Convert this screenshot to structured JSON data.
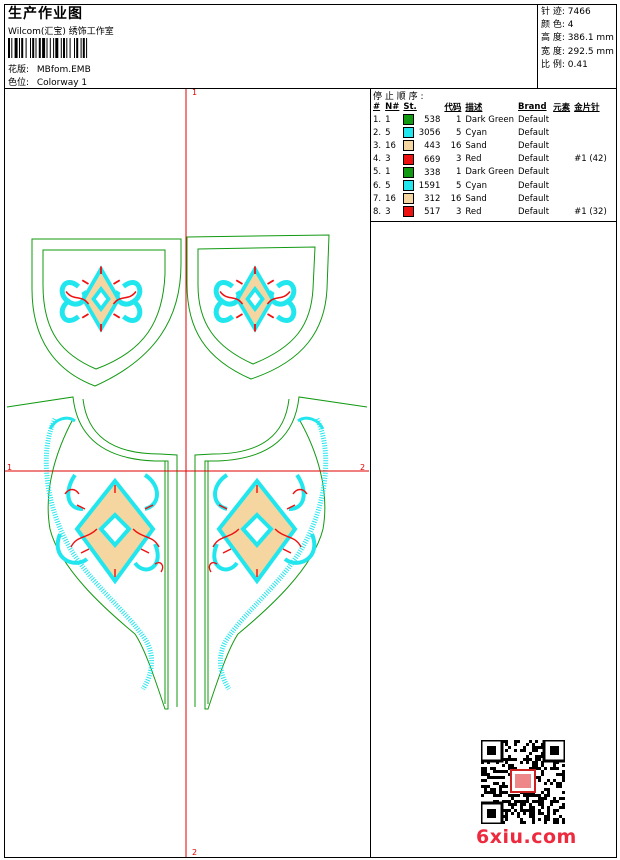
{
  "header": {
    "title": "生产作业图",
    "company": "Wilcom(汇宝) 绣饰工作室",
    "design_label": "花版:",
    "design_value": "MBfom.EMB",
    "color_label": "色位:",
    "color_value": "Colorway 1"
  },
  "stats": [
    {
      "label": "针 迹",
      "value": "7466"
    },
    {
      "label": "颜 色",
      "value": "4"
    },
    {
      "label": "高 度",
      "value": "386.1 mm"
    },
    {
      "label": "宽 度",
      "value": "292.5 mm"
    },
    {
      "label": "比 例",
      "value": "0.41"
    }
  ],
  "sequence": {
    "title": "停 止 顺 序 :",
    "headers": [
      "#",
      "N#",
      "St.",
      "代码",
      "描述",
      "Brand",
      "元素",
      "金片针"
    ],
    "rows": [
      {
        "idx": "1.",
        "n": "1",
        "color": "#119911",
        "st": "538",
        "code": "1",
        "desc": "Dark Green",
        "brand": "Default",
        "elem": "",
        "seq": ""
      },
      {
        "idx": "2.",
        "n": "5",
        "color": "#22e6ee",
        "st": "3056",
        "code": "5",
        "desc": "Cyan",
        "brand": "Default",
        "elem": "",
        "seq": ""
      },
      {
        "idx": "3.",
        "n": "16",
        "color": "#f5d6a0",
        "st": "443",
        "code": "16",
        "desc": "Sand",
        "brand": "Default",
        "elem": "",
        "seq": ""
      },
      {
        "idx": "4.",
        "n": "3",
        "color": "#ee1111",
        "st": "669",
        "code": "3",
        "desc": "Red",
        "brand": "Default",
        "elem": "",
        "seq": "#1 (42)"
      },
      {
        "idx": "5.",
        "n": "1",
        "color": "#119911",
        "st": "338",
        "code": "1",
        "desc": "Dark Green",
        "brand": "Default",
        "elem": "",
        "seq": ""
      },
      {
        "idx": "6.",
        "n": "5",
        "color": "#22e6ee",
        "st": "1591",
        "code": "5",
        "desc": "Cyan",
        "brand": "Default",
        "elem": "",
        "seq": ""
      },
      {
        "idx": "7.",
        "n": "16",
        "color": "#f5d6a0",
        "st": "312",
        "code": "16",
        "desc": "Sand",
        "brand": "Default",
        "elem": "",
        "seq": ""
      },
      {
        "idx": "8.",
        "n": "3",
        "color": "#ee1111",
        "st": "517",
        "code": "3",
        "desc": "Red",
        "brand": "Default",
        "elem": "",
        "seq": "#1 (32)"
      }
    ]
  },
  "axes": {
    "top": "1",
    "bottom": "2",
    "left": "1",
    "right": "2"
  },
  "colors": {
    "outline": "#119911",
    "cyan": "#22e6ee",
    "sand": "#f5d6a0",
    "red": "#ee1111",
    "axis": "#e00000"
  },
  "watermark": {
    "brand": "6xiu.com"
  }
}
